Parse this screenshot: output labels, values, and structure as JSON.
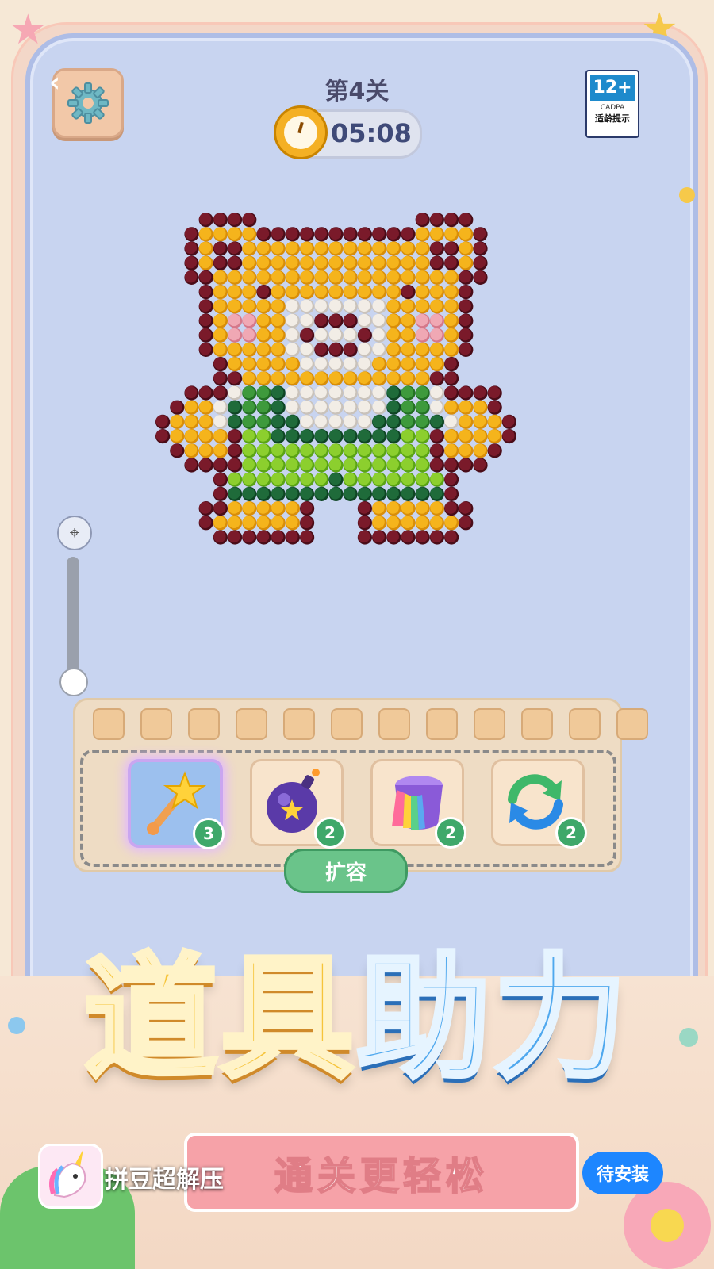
{
  "header": {
    "back_label": "‹",
    "level_title": "第4关",
    "timer": "05:08",
    "age_rating": {
      "number": "12+",
      "org": "CADPA",
      "tip": "适龄提示"
    }
  },
  "icons": {
    "settings": "gear-icon",
    "zoom_target": "crosshair-icon",
    "timer": "stopwatch-icon"
  },
  "board": {
    "palette": {
      "Y": "#f5b41c",
      "D": "#7a1a2a",
      "W": "#f2ede6",
      "P": "#f0a8b4",
      "G": "#3e9a3c",
      "L": "#8ccf2e",
      "E": "#1f6b3a"
    },
    "rows": [
      "...DDDD...........DDDD...",
      "..DYYYYDDDDDDDDDDDYYYYD..",
      "..DYDDYYYYYYYYYYYYYDDYD..",
      "..DYDDYYYYYYYYYYYYYDDYD..",
      "..DDYYYYYYYYYYYYYYYYYDD..",
      "...DYYYDYYYYYYYYYDYYYD...",
      "...DYYYYYWWWWWWWYYYYYD...",
      "...DYPPYYWWDDDWWYYPPYD...",
      "...DYPPYYWDWWWDWYYPPYD...",
      "...DYYYYYWWDDDWWYYYYYD...",
      "....DYYYYYWWWWWYYYYYD....",
      "....DDYYYYYYYYYYYYYDD....",
      "..DDDWGGEWWWWWWWEGGWDDDD.",
      ".DYYWEGGEWWWWWWWEGGWYYYD.",
      "DYYYWEGGEEWWWWWEEGGEWYYYD",
      "DYYYYDLLEEEEEEEEELLDYYYYD",
      ".DYYYDLLLLLLLLLLLLLDYYYD.",
      "..DDDDLLLLLLLLLLLLLDDDD..",
      "....DLLLLLLLELLLLLLLD....",
      "....DEEEEEEEEEEEEEEED....",
      "...DDYYYYYD...DYYYYYDD...",
      "...DYYYYYYD...DYYYYYYD...",
      "....DDDDDDD...DDDDDDD...."
    ]
  },
  "tray": {
    "slot_count": 12,
    "tools": [
      {
        "name": "magic-wand",
        "count": "3",
        "active": true
      },
      {
        "name": "bomb",
        "count": "2",
        "active": false
      },
      {
        "name": "paint-bucket",
        "count": "2",
        "active": false
      },
      {
        "name": "refresh",
        "count": "2",
        "active": false
      }
    ],
    "expand_label": "扩容"
  },
  "promo": {
    "title_part1": "道具",
    "title_part2": "助力",
    "subtitle": "通关更轻松"
  },
  "ad_bar": {
    "app_name": "拼豆超解压",
    "install_label": "待安装"
  }
}
